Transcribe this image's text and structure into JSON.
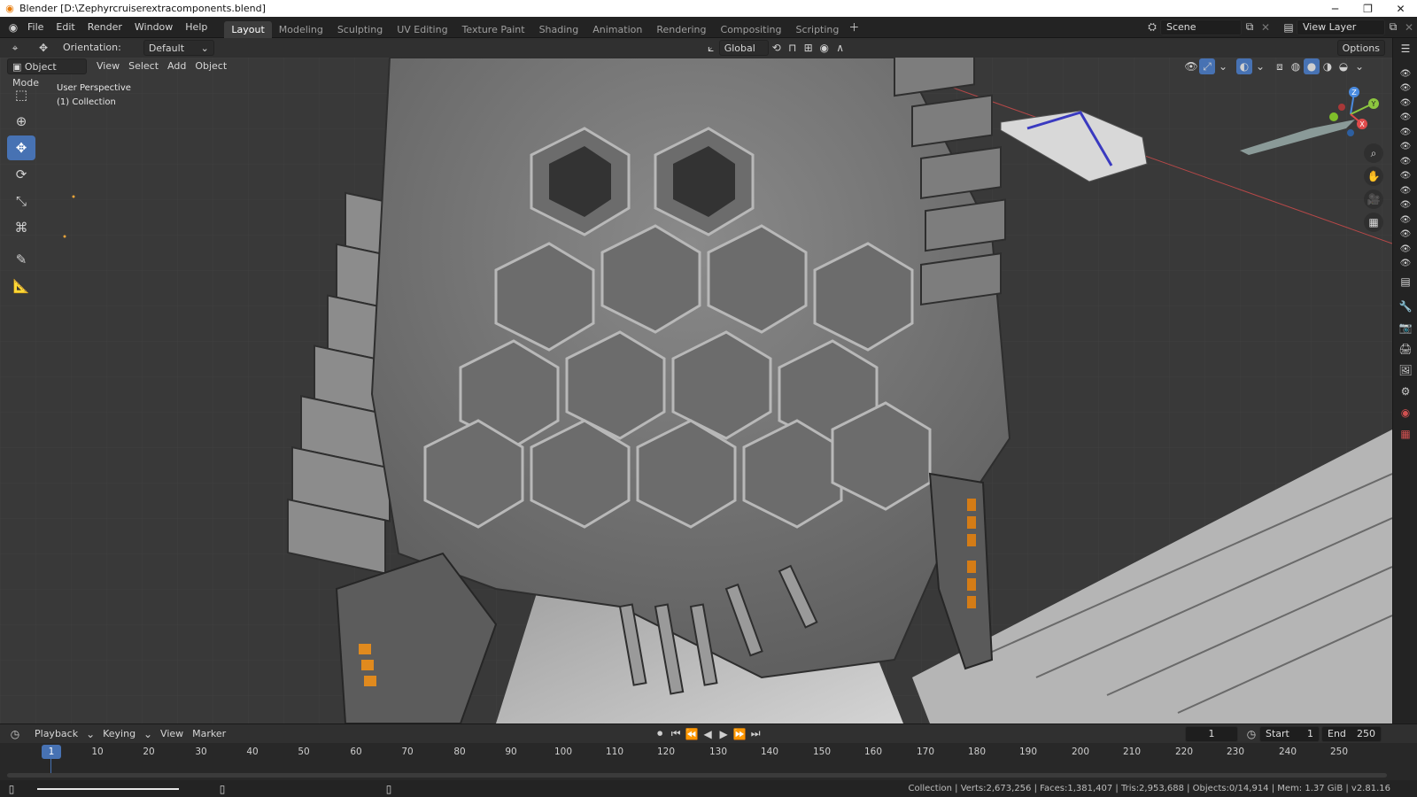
{
  "window": {
    "title": "Blender [D:\\Zephyrcruiserextracomponents.blend]",
    "minimize": "─",
    "maximize": "❐",
    "close": "✕"
  },
  "menu": [
    "File",
    "Edit",
    "Render",
    "Window",
    "Help"
  ],
  "workspaces": [
    {
      "label": "Layout",
      "active": true
    },
    {
      "label": "Modeling"
    },
    {
      "label": "Sculpting"
    },
    {
      "label": "UV Editing"
    },
    {
      "label": "Texture Paint"
    },
    {
      "label": "Shading"
    },
    {
      "label": "Animation"
    },
    {
      "label": "Rendering"
    },
    {
      "label": "Compositing"
    },
    {
      "label": "Scripting"
    }
  ],
  "scene": {
    "label": "Scene"
  },
  "view_layer": {
    "label": "View Layer"
  },
  "viewport_header": {
    "orientation_label": "Orientation:",
    "orientation_value": "Default",
    "transform_space": "Global",
    "options": "Options"
  },
  "mode_bar": {
    "mode": "Object Mode",
    "view": "View",
    "select": "Select",
    "add": "Add",
    "object": "Object"
  },
  "viewport_info": {
    "perspective": "User Perspective",
    "collection": "(1) Collection"
  },
  "gizmo": {
    "x": "X",
    "y": "Y",
    "z": "Z"
  },
  "timeline": {
    "playback": "Playback",
    "keying": "Keying",
    "view": "View",
    "marker": "Marker",
    "current_frame": "1",
    "start_label": "Start",
    "start": "1",
    "end_label": "End",
    "end": "250",
    "ticks": [
      "10",
      "20",
      "30",
      "40",
      "50",
      "60",
      "70",
      "80",
      "90",
      "100",
      "110",
      "120",
      "130",
      "140",
      "150",
      "160",
      "170",
      "180",
      "190",
      "200",
      "210",
      "220",
      "230",
      "240",
      "250"
    ]
  },
  "statusbar": {
    "stats": "Collection | Verts:2,673,256 | Faces:1,381,407 | Tris:2,953,688 | Objects:0/14,914 | Mem: 1.37 GiB | v2.81.16"
  },
  "colors": {
    "accent": "#4772b3",
    "x_axis": "#e04b4b",
    "y_axis": "#8cc63f",
    "z_axis": "#4a8be0"
  }
}
